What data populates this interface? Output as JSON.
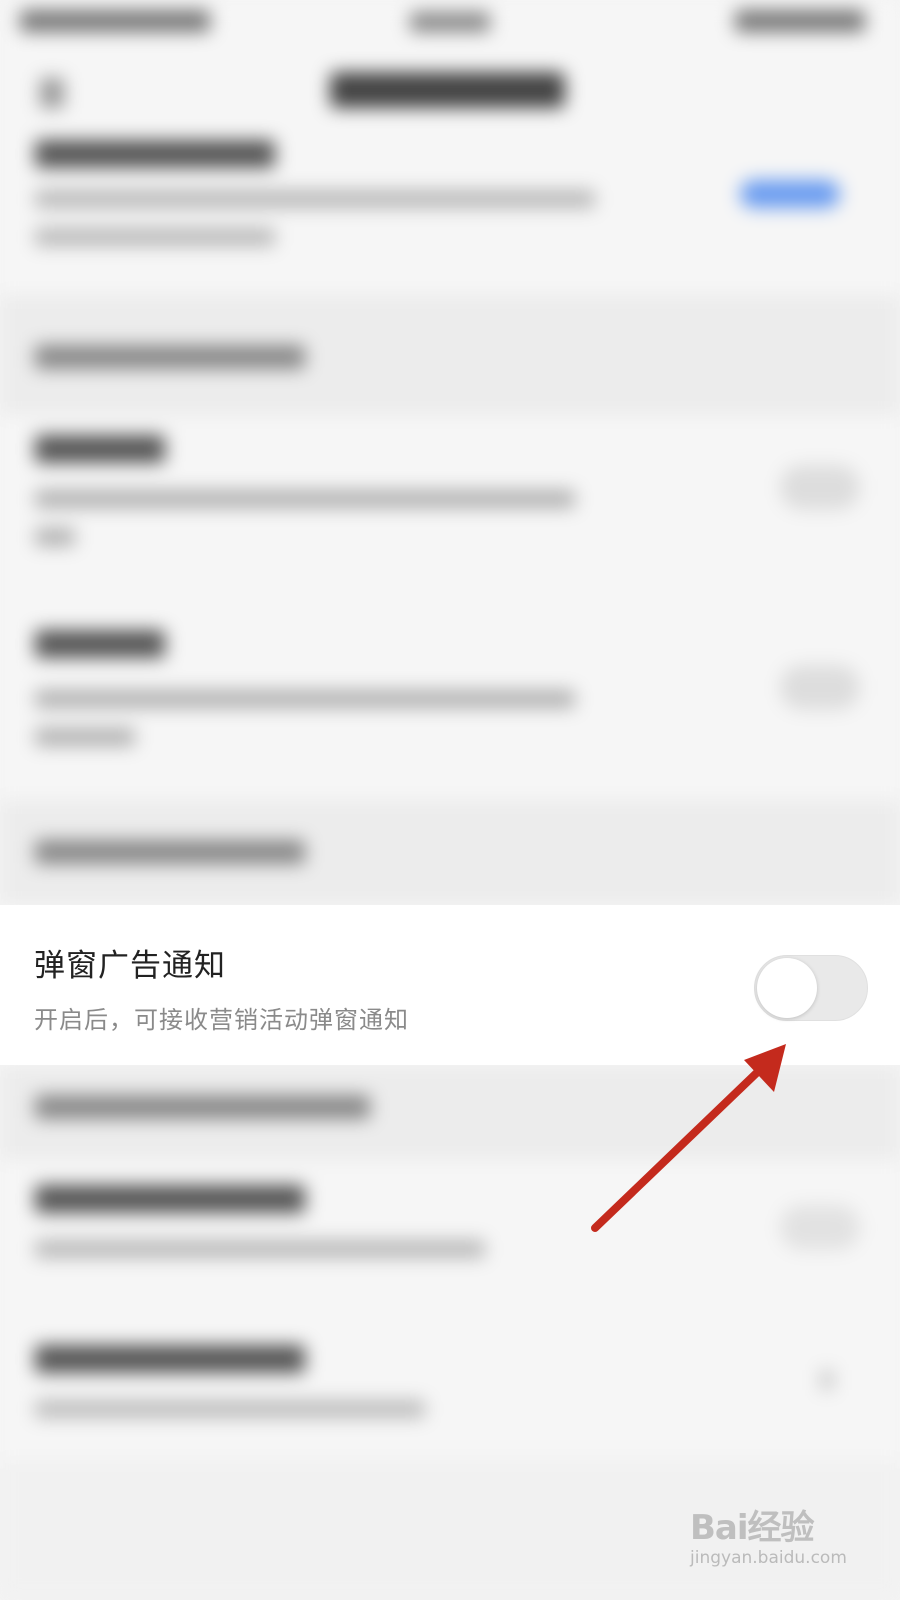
{
  "setting": {
    "title": "弹窗广告通知",
    "description": "开启后，可接收营销活动弹窗通知",
    "toggle_state": "off",
    "toggle_on": false
  },
  "watermark": {
    "brand": "Bai经验",
    "url": "jingyan.baidu.com"
  },
  "colors": {
    "arrow": "#c42a1d",
    "toggle_off_track": "#e9e9e9",
    "title_text": "#222222",
    "description_text": "#8a8a8a"
  }
}
